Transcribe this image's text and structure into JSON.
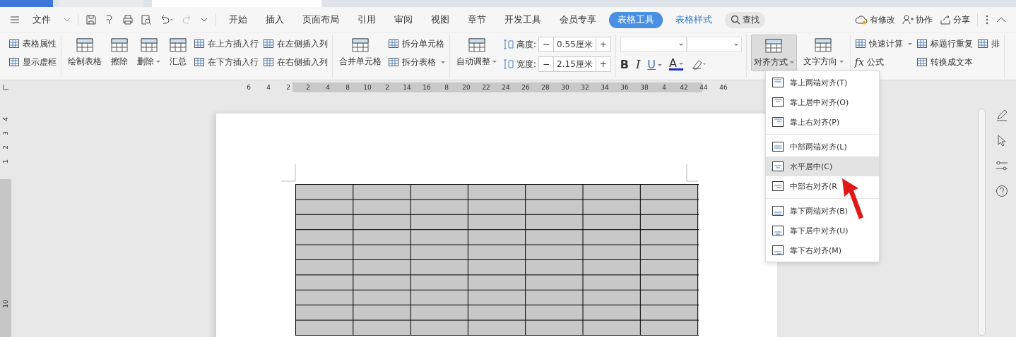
{
  "menu_bar": {
    "file_label": "文件",
    "tabs": [
      {
        "label": "开始",
        "kind": "tab",
        "selected": false
      },
      {
        "label": "插入",
        "kind": "tab",
        "selected": false
      },
      {
        "label": "页面布局",
        "kind": "tab",
        "selected": false
      },
      {
        "label": "引用",
        "kind": "tab",
        "selected": false
      },
      {
        "label": "审阅",
        "kind": "tab",
        "selected": false
      },
      {
        "label": "视图",
        "kind": "tab",
        "selected": false
      },
      {
        "label": "章节",
        "kind": "tab",
        "selected": false
      },
      {
        "label": "开发工具",
        "kind": "tab",
        "selected": false
      },
      {
        "label": "会员专享",
        "kind": "tab",
        "selected": false
      },
      {
        "label": "表格工具",
        "kind": "context",
        "selected": true
      },
      {
        "label": "表格样式",
        "kind": "context",
        "selected": false
      }
    ],
    "search_label": "查找",
    "actions": [
      {
        "label": "有修改",
        "kind": "cloud"
      },
      {
        "label": "协作",
        "kind": "person"
      },
      {
        "label": "分享",
        "kind": "share"
      }
    ]
  },
  "ribbon": {
    "groups": [
      {
        "columns": [
          {
            "kind": "stack",
            "items": [
              {
                "label": "表格属性",
                "dropdown": false
              },
              {
                "label": "显示虚框",
                "dropdown": false
              }
            ]
          }
        ]
      },
      {
        "columns": [
          {
            "kind": "big",
            "label": "绘制表格",
            "dropdown": false,
            "active": false
          },
          {
            "kind": "big",
            "label": "擦除",
            "dropdown": false,
            "active": false
          },
          {
            "kind": "big",
            "label": "删除",
            "dropdown": true,
            "active": false
          },
          {
            "kind": "big",
            "label": "汇总",
            "dropdown": false,
            "active": false
          },
          {
            "kind": "stack",
            "items": [
              {
                "label": "在上方插入行",
                "dropdown": false
              },
              {
                "label": "在下方插入行",
                "dropdown": false
              }
            ]
          },
          {
            "kind": "stack",
            "items": [
              {
                "label": "在左侧插入列",
                "dropdown": false
              },
              {
                "label": "在右侧插入列",
                "dropdown": false
              }
            ]
          }
        ]
      },
      {
        "columns": [
          {
            "kind": "big",
            "label": "合并单元格",
            "dropdown": false,
            "active": false
          },
          {
            "kind": "stack",
            "items": [
              {
                "label": "拆分单元格",
                "dropdown": false
              },
              {
                "label": "拆分表格",
                "dropdown": true
              }
            ]
          }
        ]
      },
      {
        "columns": [
          {
            "kind": "big",
            "label": "自动调整",
            "dropdown": true,
            "active": false
          },
          {
            "kind": "spinners",
            "items": [
              {
                "label": "高度:",
                "value": "0.55厘米",
                "minus": "−",
                "plus": "+"
              },
              {
                "label": "宽度:",
                "value": "2.15厘米",
                "minus": "−",
                "plus": "+"
              }
            ]
          }
        ]
      },
      {
        "columns": [
          {
            "kind": "font",
            "buttons": [
              {
                "label": "B",
                "dropdown": false
              },
              {
                "label": "I",
                "dropdown": false
              },
              {
                "label": "U",
                "dropdown": true
              },
              {
                "label": "A",
                "dropdown": true
              }
            ]
          }
        ]
      },
      {
        "columns": [
          {
            "kind": "big",
            "label": "对齐方式",
            "dropdown": true,
            "active": true
          },
          {
            "kind": "big",
            "label": "文字方向",
            "dropdown": true,
            "active": false
          }
        ]
      },
      {
        "columns": [
          {
            "kind": "stack",
            "items": [
              {
                "label": "快速计算",
                "dropdown": true
              },
              {
                "label": "公式",
                "prefix": "fx",
                "dropdown": false
              }
            ]
          },
          {
            "kind": "stack",
            "items": [
              {
                "label": "标题行重复",
                "dropdown": false
              },
              {
                "label": "转换成文本",
                "dropdown": false
              }
            ]
          },
          {
            "kind": "stack",
            "items": [
              {
                "label": "排",
                "dropdown": false
              }
            ]
          }
        ]
      }
    ]
  },
  "ruler": {
    "horizontal": [
      "6",
      "4",
      "2",
      "2",
      "4",
      "8",
      "10",
      "2",
      "14",
      "16",
      "8",
      "20",
      "22",
      "24",
      "26",
      "28",
      "30",
      "32",
      "34",
      "36",
      "38",
      "4",
      "42",
      "44",
      "46"
    ],
    "vertical": [
      "4",
      "3",
      "2",
      "1",
      "10"
    ]
  },
  "align_menu": {
    "sections": [
      {
        "items": [
          {
            "label": "靠上两端对齐(T)",
            "kind": "top-left",
            "selected": false
          },
          {
            "label": "靠上居中对齐(O)",
            "kind": "top-center",
            "selected": false
          },
          {
            "label": "靠上右对齐(P)",
            "kind": "top-right",
            "selected": false
          }
        ]
      },
      {
        "items": [
          {
            "label": "中部两端对齐(L)",
            "kind": "middle-left",
            "selected": false
          },
          {
            "label": "水平居中(C)",
            "kind": "middle-center",
            "selected": true
          },
          {
            "label": "中部右对齐(R",
            "kind": "middle-right",
            "selected": false
          }
        ]
      },
      {
        "items": [
          {
            "label": "靠下两端对齐(B)",
            "kind": "bottom-left",
            "selected": false
          },
          {
            "label": "靠下居中对齐(U)",
            "kind": "bottom-center",
            "selected": false
          },
          {
            "label": "靠下右对齐(M)",
            "kind": "bottom-right",
            "selected": false
          }
        ]
      }
    ]
  }
}
